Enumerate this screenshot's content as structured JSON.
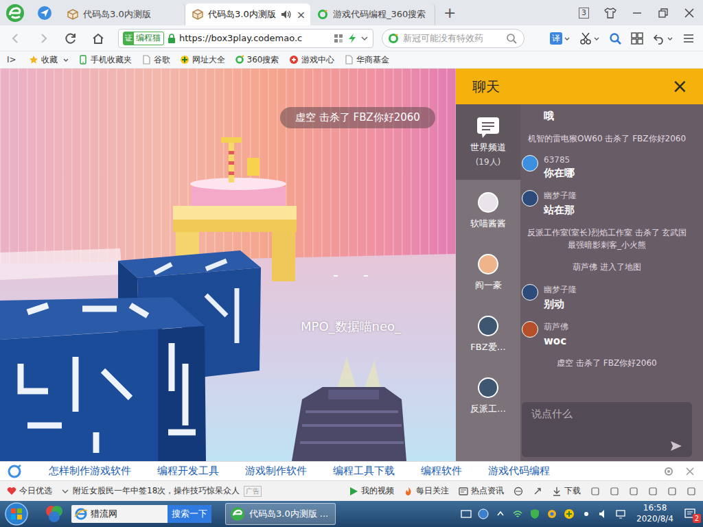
{
  "browser": {
    "tabs": [
      {
        "label": "代码岛3.0内测版",
        "kind": "codemao",
        "audio": false,
        "selected": false
      },
      {
        "label": "代码岛3.0内测版",
        "kind": "codemao",
        "audio": true,
        "close": "×",
        "selected": true
      },
      {
        "label": "游戏代码编程_360搜索",
        "kind": "search",
        "audio": false,
        "selected": false
      }
    ],
    "new_tab": "+",
    "tab_count": "3",
    "address": {
      "badge_icon": "证",
      "badge": "编程猫",
      "url": "https://box3play.codemao.c"
    },
    "search": {
      "placeholder": "新冠可能没有特效药"
    },
    "translate": "译",
    "bookmarks_toggle": "I>",
    "bookmarks": [
      {
        "label": "收藏",
        "kind": "star"
      },
      {
        "label": "手机收藏夹",
        "kind": "phone"
      },
      {
        "label": "谷歌",
        "kind": "page"
      },
      {
        "label": "网址大全",
        "kind": "web"
      },
      {
        "label": "360搜索",
        "kind": "search360"
      },
      {
        "label": "游戏中心",
        "kind": "game"
      },
      {
        "label": "华商基金",
        "kind": "page"
      }
    ]
  },
  "game": {
    "kill_banner": "虚空 击杀了 FBZ你好2060",
    "player_name": "MPO_数据喵neo_"
  },
  "chat": {
    "title": "聊天",
    "close": "×",
    "channels": [
      {
        "label": "世界频道",
        "count": "(19人)",
        "kind": "world",
        "selected": true
      },
      {
        "label": "软喵酱酱",
        "kind": "user",
        "color": "#e8e4ea",
        "selected": false
      },
      {
        "label": "阎一豪",
        "kind": "user",
        "color": "#f0b48a",
        "selected": false
      },
      {
        "label": "FBZ爱…",
        "kind": "user",
        "color": "#3f5670",
        "selected": false
      },
      {
        "label": "反派工…",
        "kind": "user",
        "color": "#3f5670",
        "selected": false
      }
    ],
    "messages": [
      {
        "kind": "text",
        "text": "哦"
      },
      {
        "kind": "system",
        "text": "机智的雷电猴OW60 击杀了 FBZ你好2060"
      },
      {
        "kind": "user",
        "name": "63785",
        "text": "你在哪",
        "color": "#3d8fe0"
      },
      {
        "kind": "user",
        "name": "幽梦子隆",
        "text": "站在那",
        "color": "#2c4a7a"
      },
      {
        "kind": "system",
        "text": "反派工作室(室长)烈焰工作室 击杀了 玄武国最强暗影刺客_小火熊"
      },
      {
        "kind": "system",
        "text": "葫芦佛 进入了地图"
      },
      {
        "kind": "user",
        "name": "幽梦子隆",
        "text": "别动",
        "color": "#2c4a7a"
      },
      {
        "kind": "user",
        "name": "葫芦佛",
        "text": "woc",
        "color": "#b5502a"
      },
      {
        "kind": "system",
        "text": "虚空 击杀了 FBZ你好2060"
      }
    ],
    "input": {
      "placeholder": "说点什么"
    }
  },
  "suggestions": [
    "怎样制作游戏软件",
    "编程开发工具",
    "游戏制作软件",
    "编程工具下载",
    "编程软件",
    "游戏代码编程"
  ],
  "status_bar": {
    "today": "今日优选",
    "news": "附近女股民一年中签18次，操作技巧惊呆众人",
    "ad": "广告",
    "items": [
      "我的视频",
      "每日关注",
      "热点资讯"
    ],
    "download": "下载"
  },
  "taskbar": {
    "search": {
      "value": "猎流网",
      "button": "搜索一下"
    },
    "windows": [
      {
        "label": "代码岛3.0内测版 ...",
        "selected": true
      }
    ],
    "time": "16:58",
    "date": "2020/8/4",
    "badge": "2"
  }
}
